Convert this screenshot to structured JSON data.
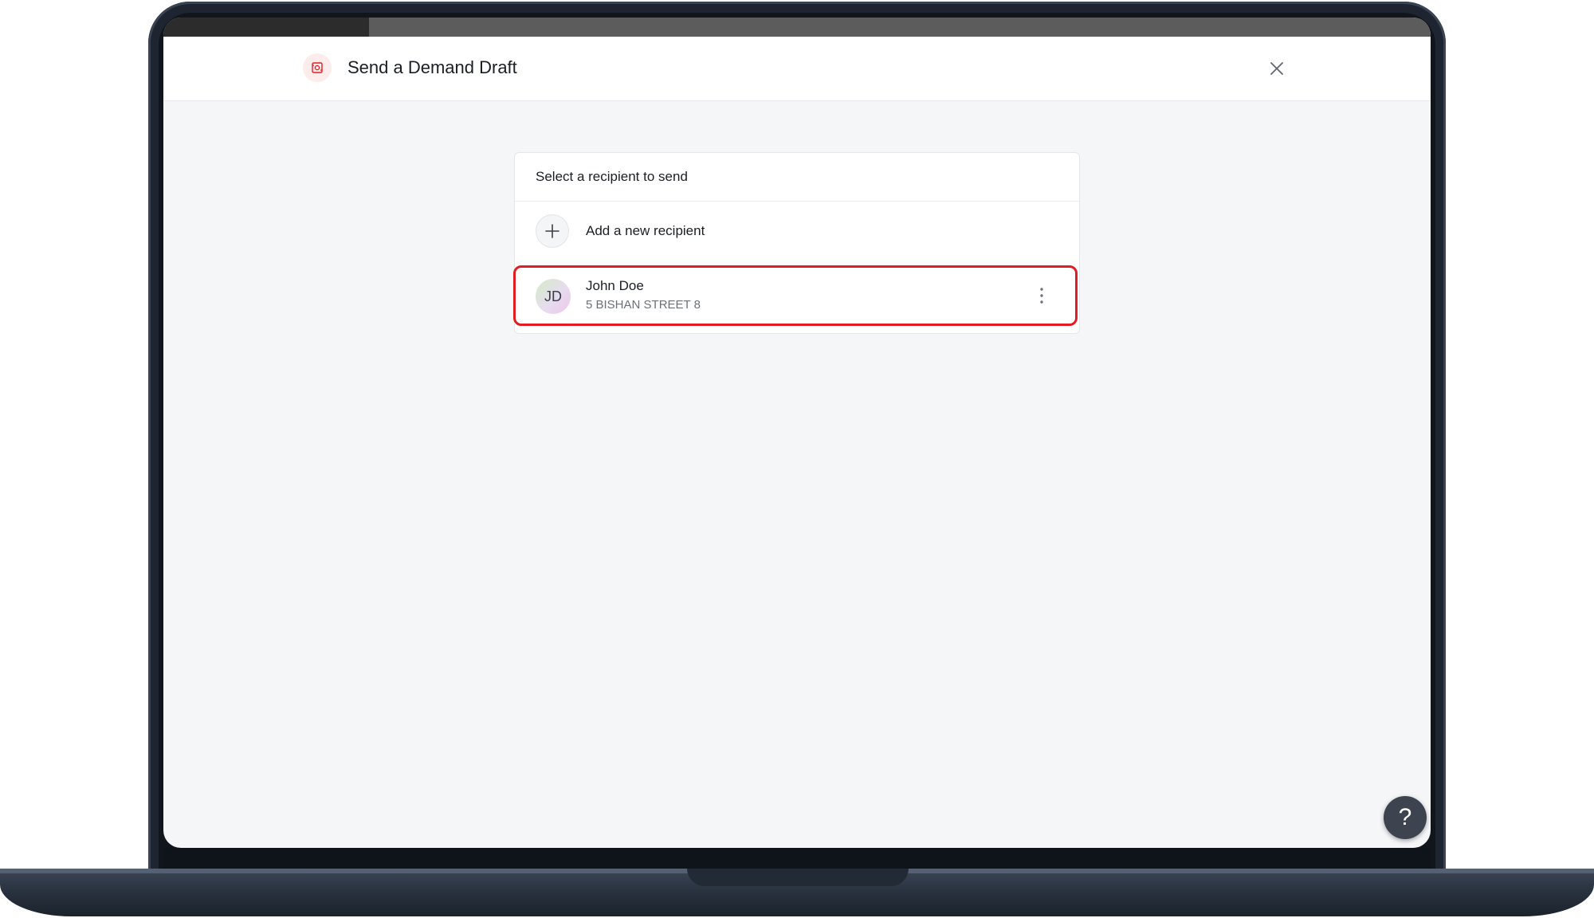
{
  "modal": {
    "title": "Send a Demand Draft",
    "header_icon": "demand-draft-icon",
    "close_icon": "close-icon"
  },
  "recipients": {
    "heading": "Select a recipient to send",
    "add_label": "Add a new recipient",
    "add_icon": "plus-icon",
    "list": [
      {
        "initials": "JD",
        "name": "John Doe",
        "address": "5 BISHAN STREET 8",
        "more_icon": "more-vertical-icon",
        "highlighted": true
      }
    ]
  },
  "help": {
    "label": "?"
  },
  "colors": {
    "accent": "#e11d23",
    "background": "#f5f6f8",
    "help_button": "#3d4450"
  }
}
